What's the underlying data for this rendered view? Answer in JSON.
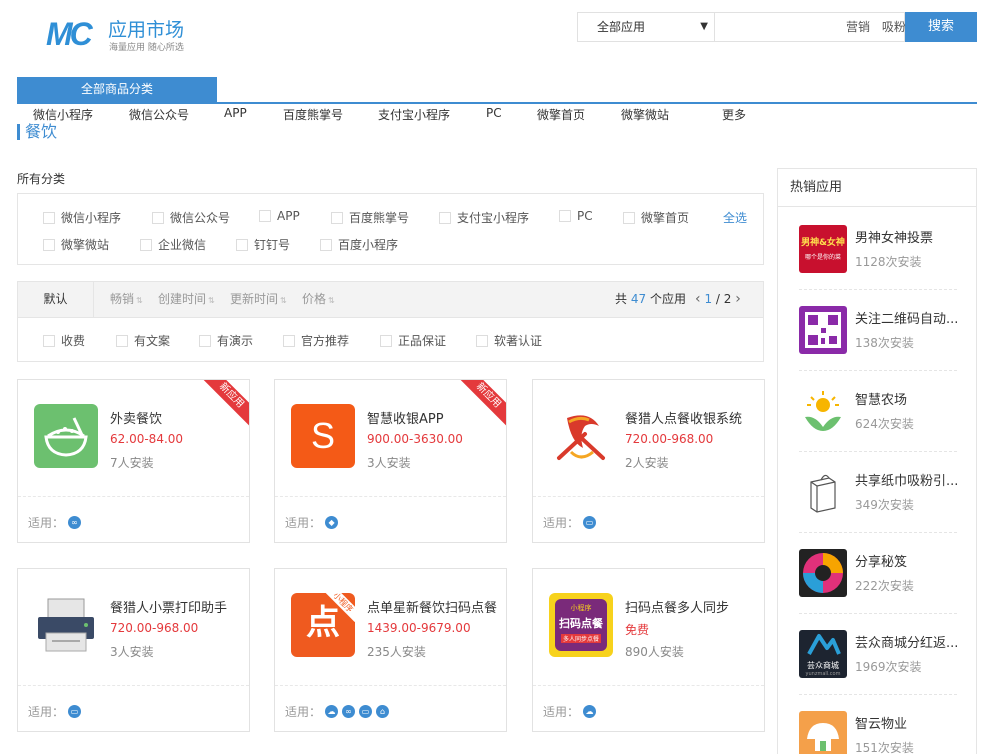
{
  "header": {
    "logo_mark": "MC",
    "logo_title": "应用市场",
    "logo_sub": "海量应用 随心所选",
    "search_select": "全部应用",
    "hot_words": [
      "营销",
      "吸粉"
    ],
    "search_button": "搜索"
  },
  "category": {
    "all_button": "全部商品分类",
    "nav": [
      "微信小程序",
      "微信公众号",
      "APP",
      "百度熊掌号",
      "支付宝小程序",
      "PC",
      "微擎首页",
      "微擎微站",
      "更多"
    ]
  },
  "page_title": "餐饮",
  "filters": {
    "label": "所有分类",
    "options": [
      "微信小程序",
      "微信公众号",
      "APP",
      "百度熊掌号",
      "支付宝小程序",
      "PC",
      "微擎首页",
      "微擎微站",
      "企业微信",
      "钉钉号",
      "百度小程序"
    ],
    "select_all": "全选"
  },
  "sort": {
    "default": "默认",
    "items": [
      "畅销",
      "创建时间",
      "更新时间",
      "价格"
    ],
    "total_prefix": "共",
    "total": "47",
    "total_suffix": "个应用",
    "page_current": "1",
    "page_total": "/ 2"
  },
  "tags": [
    "收费",
    "有文案",
    "有演示",
    "官方推荐",
    "正品保证",
    "软著认证"
  ],
  "suit_label": "适用：",
  "products": [
    {
      "name": "外卖餐饮",
      "price": "62.00-84.00",
      "installs": "7人安装",
      "ribbon": "新应用"
    },
    {
      "name": "智慧收银APP",
      "price": "900.00-3630.00",
      "installs": "3人安装",
      "ribbon": "新应用",
      "icon_letter": "S"
    },
    {
      "name": "餐猎人点餐收银系统",
      "price": "720.00-968.00",
      "installs": "2人安装"
    },
    {
      "name": "餐猎人小票打印助手",
      "price": "720.00-968.00",
      "installs": "3人安装"
    },
    {
      "name": "点单星新餐饮扫码点餐",
      "price": "1439.00-9679.00",
      "installs": "235人安装",
      "icon_badge": "小程序",
      "icon_glyph": "点"
    },
    {
      "name": "扫码点餐多人同步",
      "price": "免费",
      "installs": "890人安装",
      "icon_text_top": "小程序",
      "icon_text_mid": "扫码点餐",
      "icon_text_bottom": "多人同步点餐"
    }
  ],
  "hot_apps": {
    "title": "热销应用",
    "items": [
      {
        "name": "男神女神投票",
        "count": "1128次安装",
        "icon_text": "男神&女神",
        "icon_sub": "哪个是你的菜"
      },
      {
        "name": "关注二维码自动...",
        "count": "138次安装"
      },
      {
        "name": "智慧农场",
        "count": "624次安装"
      },
      {
        "name": "共享纸巾吸粉引...",
        "count": "349次安装"
      },
      {
        "name": "分享秘笈",
        "count": "222次安装"
      },
      {
        "name": "芸众商城分红返...",
        "count": "1969次安装",
        "icon_text": "芸众商城",
        "icon_sub": "yunzmall.com"
      },
      {
        "name": "智云物业",
        "count": "151次安装"
      }
    ]
  },
  "colors": {
    "accent": "#3e8cd1",
    "price": "#e4393c"
  }
}
